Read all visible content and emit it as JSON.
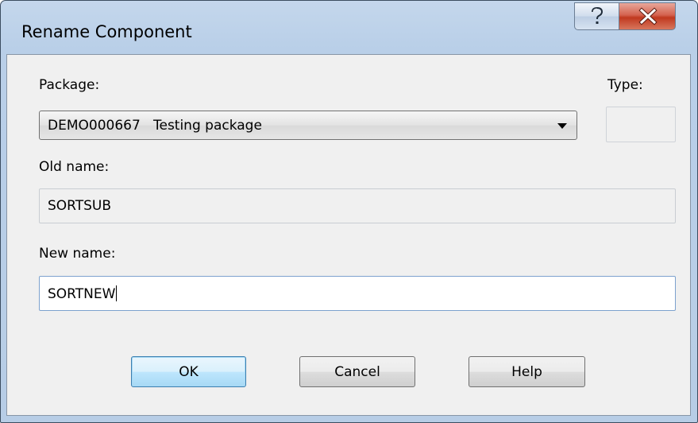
{
  "window": {
    "title": "Rename Component"
  },
  "titlebar": {
    "help_glyph": "?",
    "close_glyph": "x"
  },
  "package": {
    "label": "Package:",
    "value": "DEMO000667   Testing package"
  },
  "type": {
    "label": "Type:",
    "value": ""
  },
  "old_name": {
    "label": "Old name:",
    "value": "SORTSUB"
  },
  "new_name": {
    "label": "New name:",
    "value": "SORTNEW"
  },
  "buttons": {
    "ok": "OK",
    "cancel": "Cancel",
    "help": "Help"
  },
  "icons": {
    "help": "question-mark-icon",
    "close": "close-x-icon",
    "dropdown": "dropdown-arrow-icon"
  }
}
